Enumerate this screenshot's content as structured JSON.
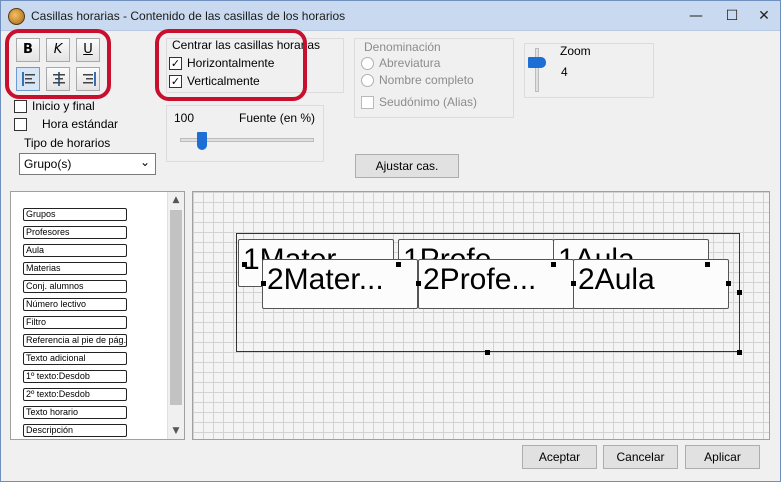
{
  "window": {
    "title": "Casillas horarias - Contenido de las casillas de los horarios",
    "minimize": "—",
    "maximize": "☐",
    "close": "✕"
  },
  "format": {
    "bold": "B",
    "italic": "K",
    "underline": "U"
  },
  "center": {
    "heading": "Centrar las casillas horarias",
    "horizontal_label": "Horizontalmente",
    "horizontal_checked": true,
    "vertical_label": "Verticalmente",
    "vertical_checked": true
  },
  "options": {
    "inicio_final_label": "Inicio y final",
    "hora_estandar_label": "Hora estándar",
    "tipo_label": "Tipo de horarios",
    "tipo_value": "Grupo(s)"
  },
  "font": {
    "size_value": "100",
    "label": "Fuente (en %)",
    "slider_level_percent": 14
  },
  "denominacion": {
    "heading": "Denominación",
    "abreviatura": "Abreviatura",
    "nombre_completo": "Nombre completo",
    "seudonimo": "Seudónimo (Alias)"
  },
  "zoom": {
    "label": "Zoom",
    "value": "4"
  },
  "ajustar_label": "Ajustar cas.",
  "fields": [
    "Grupos",
    "Profesores",
    "Aula",
    "Materias",
    "Conj. alumnos",
    "Número lectivo",
    "Filtro",
    "Referencia al pie de pág.",
    "Texto adicional",
    "1º texto:Desdob",
    "2º texto:Desdob",
    "Texto horario",
    "Descripción"
  ],
  "preview": {
    "row1": [
      "1Mater...",
      "1Profe...",
      "1Aula"
    ],
    "row2": [
      "2Mater...",
      "2Profe...",
      "2Aula"
    ]
  },
  "footer": {
    "accept": "Aceptar",
    "cancel": "Cancelar",
    "apply": "Aplicar"
  },
  "colors": {
    "highlight": "#c8102e",
    "accent": "#1d6fd6"
  }
}
